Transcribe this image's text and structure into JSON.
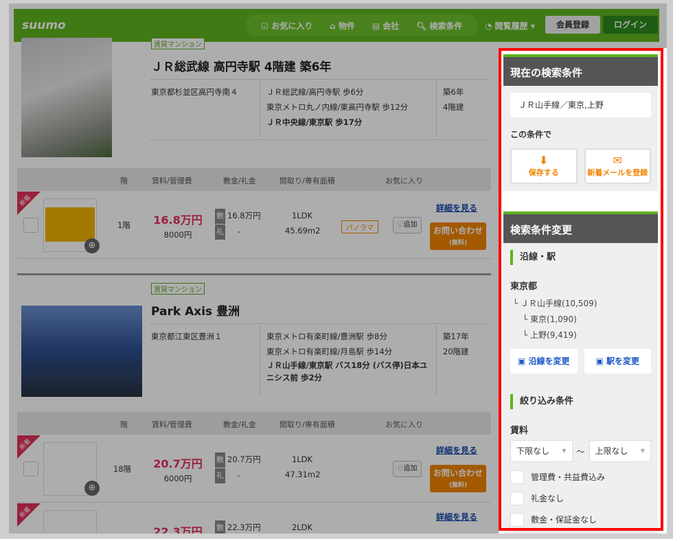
{
  "header": {
    "logo": "suumo",
    "nav": [
      "お気に入り",
      "物件",
      "会社",
      "検索条件"
    ],
    "history": "閲覧履歴",
    "register": "会員登録",
    "login": "ログイン"
  },
  "table_headers": [
    "階",
    "賃料/管理費",
    "敷金/礼金",
    "間取り/専有面積",
    "お気に入り"
  ],
  "common": {
    "new_label": "新着",
    "deposit_badge": "敷",
    "key_badge": "礼",
    "fav_add": "追加",
    "detail": "詳細を見る",
    "inquiry": "お問い合わせ",
    "inquiry_sub": "(無料)",
    "panorama": "パノラマ"
  },
  "listings": [
    {
      "type": "賃貸マンション",
      "title": "ＪＲ総武線 高円寺駅 4階建 築6年",
      "address": "東京都杉並区高円寺南４",
      "access": [
        "ＪＲ総武線/高円寺駅 歩6分",
        "東京メトロ丸ノ内線/東高円寺駅 歩12分",
        "ＪＲ中央線/東京駅 歩17分"
      ],
      "age": "築6年",
      "floors": "4階建",
      "rooms": [
        {
          "floor": "1階",
          "rent": "16.8万円",
          "fee": "8000円",
          "deposit": "16.8万円",
          "key": "-",
          "layout": "1LDK",
          "area": "45.69m2"
        }
      ]
    },
    {
      "type": "賃貸マンション",
      "title": "Park Axis 豊洲",
      "address": "東京都江東区豊洲１",
      "access": [
        "東京メトロ有楽町線/豊洲駅 歩8分",
        "東京メトロ有楽町線/月島駅 歩14分",
        "ＪＲ山手線/東京駅 バス18分 (バス停)日本ユニシス前 歩2分"
      ],
      "age": "築17年",
      "floors": "20階建",
      "rooms": [
        {
          "floor": "18階",
          "rent": "20.7万円",
          "fee": "6000円",
          "deposit": "20.7万円",
          "key": "-",
          "layout": "1LDK",
          "area": "47.31m2"
        },
        {
          "rent": "22.3万円",
          "deposit": "22.3万円",
          "layout": "2LDK"
        }
      ]
    }
  ],
  "sidebar": {
    "current": {
      "title": "現在の検索条件",
      "condition": "ＪＲ山手線／東京,上野",
      "with_label": "この条件で",
      "save": "保存する",
      "mail": "新着メールを登録"
    },
    "change": {
      "title": "検索条件変更",
      "line_section": "沿線・駅",
      "pref": "東京都",
      "line": "└ ＪＲ山手線(10,509)",
      "stations": [
        "└ 東京(1,090)",
        "└ 上野(9,419)"
      ],
      "change_line": "沿線を変更",
      "change_station": "駅を変更",
      "filter_section": "絞り込み条件",
      "rent_label": "賃料",
      "min": "下限なし",
      "tilde": "～",
      "max": "上限なし",
      "checks": [
        "管理費・共益費込み",
        "礼金なし",
        "敷金・保証金なし"
      ]
    }
  },
  "colors": {
    "brand": "#5fb41e",
    "price": "#e1315b",
    "accent": "#f08300",
    "highlight": "#ff0000"
  }
}
